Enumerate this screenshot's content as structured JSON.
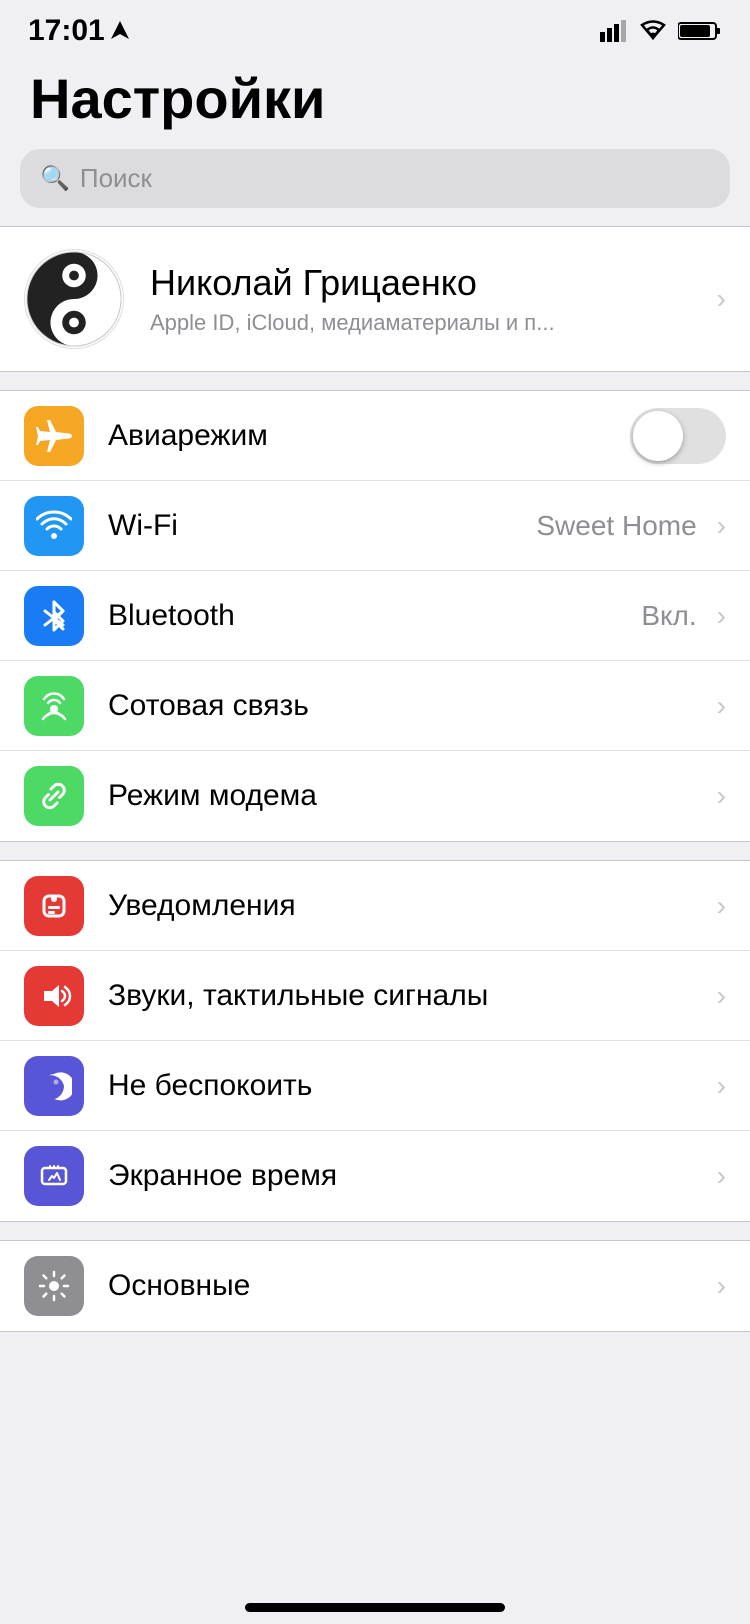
{
  "statusBar": {
    "time": "17:01",
    "locationIcon": "›"
  },
  "page": {
    "title": "Настройки",
    "searchPlaceholder": "Поиск"
  },
  "profile": {
    "name": "Николай Грицаенко",
    "subtitle": "Apple ID, iCloud, медиаматериалы и п...",
    "chevron": "›"
  },
  "settingsGroups": [
    {
      "id": "connectivity",
      "items": [
        {
          "id": "airplane",
          "label": "Авиарежим",
          "type": "toggle",
          "value": "",
          "iconColor": "#f5a623"
        },
        {
          "id": "wifi",
          "label": "Wi-Fi",
          "type": "value",
          "value": "Sweet Home",
          "iconColor": "#2196f3"
        },
        {
          "id": "bluetooth",
          "label": "Bluetooth",
          "type": "value",
          "value": "Вкл.",
          "iconColor": "#1a7cf5"
        },
        {
          "id": "cellular",
          "label": "Сотовая связь",
          "type": "chevron",
          "value": "",
          "iconColor": "#4cd964"
        },
        {
          "id": "hotspot",
          "label": "Режим модема",
          "type": "chevron",
          "value": "",
          "iconColor": "#4cd964"
        }
      ]
    },
    {
      "id": "notifications",
      "items": [
        {
          "id": "notifications",
          "label": "Уведомления",
          "type": "chevron",
          "value": "",
          "iconColor": "#e53935"
        },
        {
          "id": "sounds",
          "label": "Звуки, тактильные сигналы",
          "type": "chevron",
          "value": "",
          "iconColor": "#e53935"
        },
        {
          "id": "donotdisturb",
          "label": "Не беспокоить",
          "type": "chevron",
          "value": "",
          "iconColor": "#5856d6"
        },
        {
          "id": "screentime",
          "label": "Экранное время",
          "type": "chevron",
          "value": "",
          "iconColor": "#5856d6"
        }
      ]
    },
    {
      "id": "general",
      "items": [
        {
          "id": "general",
          "label": "Основные",
          "type": "chevron",
          "value": "",
          "iconColor": "#8e8e93"
        }
      ]
    }
  ],
  "chevronChar": "›"
}
